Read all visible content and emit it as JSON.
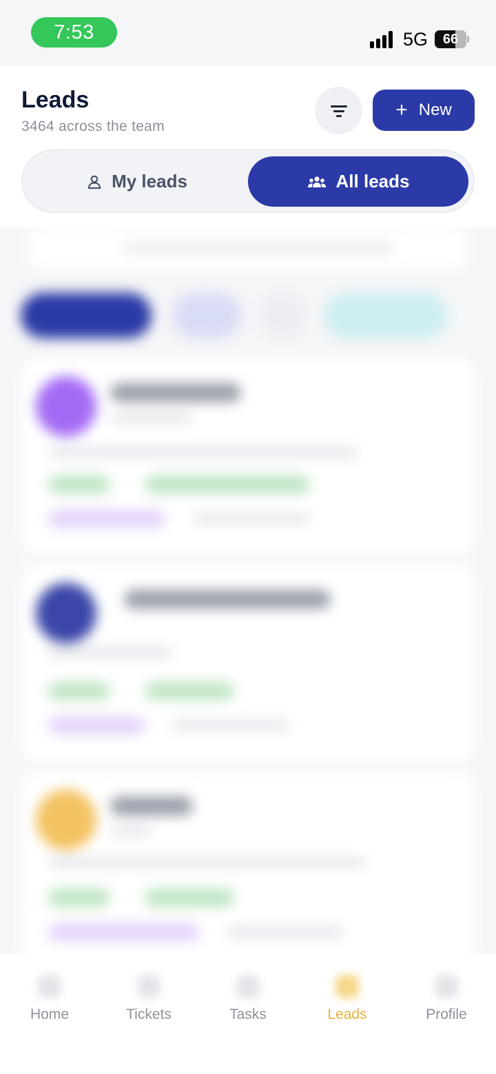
{
  "status_bar": {
    "time": "7:53",
    "network": "5G",
    "battery_percent": "66",
    "battery_level": 0.66
  },
  "header": {
    "title": "Leads",
    "subtitle": "3464 across the team",
    "filter_icon": "filter-icon",
    "new_button_label": "New"
  },
  "segmented_control": {
    "my_leads_label": "My leads",
    "all_leads_label": "All leads",
    "selected": "All leads"
  },
  "tab_bar": {
    "items": [
      {
        "label": "Home",
        "icon": "home-icon"
      },
      {
        "label": "Tickets",
        "icon": "ticket-icon"
      },
      {
        "label": "Tasks",
        "icon": "tasks-icon"
      },
      {
        "label": "Leads",
        "icon": "leads-icon"
      },
      {
        "label": "Profile",
        "icon": "profile-icon"
      }
    ],
    "active": "Leads"
  },
  "colors": {
    "primary": "#2b3aa6",
    "active_tab": "#e7b23a",
    "status_green": "#34c759",
    "avatar_purple": "#a36bf5",
    "avatar_indigo": "#3a46a8",
    "avatar_yellow": "#f3c261",
    "tag_green": "#bfe6c4",
    "tag_purple": "#e4d3fb"
  }
}
